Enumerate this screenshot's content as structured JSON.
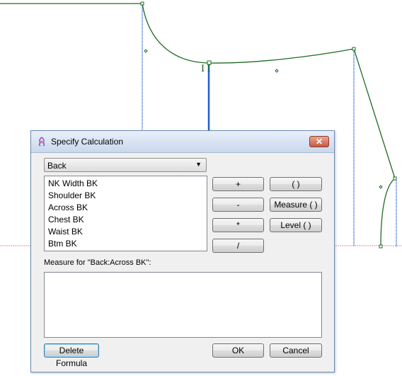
{
  "dialog": {
    "title": "Specify Calculation",
    "close_glyph": "✕",
    "dropdown": {
      "value": "Back",
      "arrow": "▼"
    },
    "measures": [
      "NK Width BK",
      "Shoulder BK",
      "Across BK",
      "Chest BK",
      "Waist BK",
      "Btm BK"
    ],
    "operator_buttons": [
      "+",
      "-",
      "*",
      "/"
    ],
    "function_buttons": [
      "( )",
      "Measure ( )",
      "Level ( )"
    ],
    "formula_label": "Measure for \"Back:Across BK\":",
    "formula_value": "",
    "delete_button": "Delete Formula",
    "ok_button": "OK",
    "cancel_button": "Cancel"
  },
  "canvas": {
    "marker_text": "I I"
  },
  "colors": {
    "pattern_line": "#1f6b25",
    "guide_line": "#1e5fd6",
    "baseline": "#e88aa0",
    "dialog_border": "#6d8bb5"
  },
  "icons": {
    "title": "calculator-app-icon",
    "close": "close-icon",
    "dropdown": "chevron-down-icon"
  }
}
